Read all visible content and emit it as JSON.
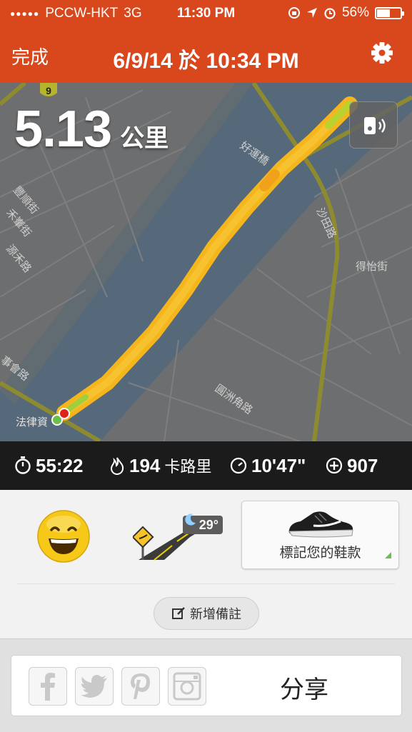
{
  "status_bar": {
    "carrier": "PCCW-HKT",
    "network": "3G",
    "time": "11:30 PM",
    "battery": "56%",
    "battery_level": 0.56
  },
  "nav": {
    "done_label": "完成",
    "title": "6/9/14 於 10:34 PM",
    "settings_icon": "gear-icon"
  },
  "map": {
    "distance_value": "5.13",
    "distance_unit": "公里",
    "route_shield": "9",
    "street_labels": [
      "豐順街",
      "禾輋街",
      "源禾路",
      "沙田路",
      "得怡街",
      "圓洲角路",
      "法律資",
      "事會路",
      "好運橋"
    ],
    "voice_button_icon": "voice-feedback-icon",
    "route_color": "#f5b51c"
  },
  "stats": {
    "duration": "55:22",
    "calories": "194",
    "calories_unit": "卡路里",
    "pace": "10'47\"",
    "fuel": "907"
  },
  "panel": {
    "mood_icon": "happy-face-icon",
    "terrain_icon": "road-icon",
    "temperature": "29°",
    "weather_icon": "moon-icon",
    "shoe_label": "標記您的鞋款",
    "add_note_label": "新增備註"
  },
  "share": {
    "label": "分享",
    "icons": [
      "facebook-icon",
      "twitter-icon",
      "pinterest-icon",
      "instagram-icon"
    ]
  }
}
